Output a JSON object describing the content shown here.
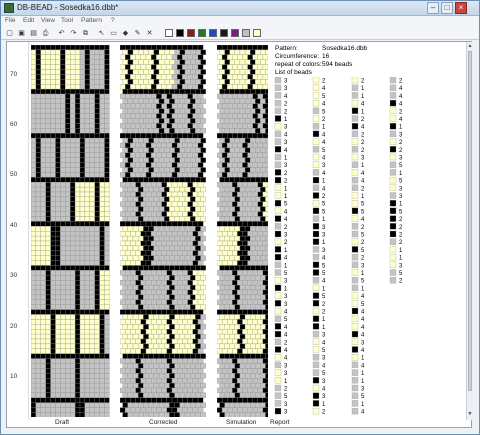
{
  "window": {
    "title": "DB-BEAD - Sosedka16.dbb*",
    "min": "–",
    "max": "□",
    "close": "×"
  },
  "menu": [
    "File",
    "Edit",
    "View",
    "Tool",
    "Pattern",
    "?"
  ],
  "toolbar": {
    "icons": [
      "new-icon",
      "open-icon",
      "save-icon",
      "print-icon",
      "undo-icon",
      "redo-icon",
      "copy-icon",
      "select-arrow-icon",
      "rect-select-icon",
      "fill-icon",
      "pencil-icon",
      "clear-icon"
    ],
    "glyphs": [
      "▢",
      "▣",
      "▤",
      "⎙",
      "↶",
      "↷",
      "⧉",
      "↖",
      "▭",
      "◆",
      "✎",
      "✕"
    ],
    "colors": [
      "#ffffff",
      "#000000",
      "#8b1a1a",
      "#1f7a1f",
      "#1c4bc7",
      "#1a1a1a",
      "#7a1a8b",
      "#c0c0c0",
      "#ffffcc"
    ]
  },
  "ruler": [
    "70",
    "60",
    "50",
    "40",
    "30",
    "20",
    "10"
  ],
  "panels": {
    "draft": "Draft",
    "corrected": "Corrected",
    "simulation": "Simulation",
    "report": "Report"
  },
  "report": {
    "pattern_label": "Pattern:",
    "pattern_value": "Sosedka16.dbb",
    "circ_label": "Circumference:",
    "circ_value": "16",
    "repeat_label": "repeat of colors:",
    "repeat_value": "594 beads",
    "list_label": "List of beads"
  },
  "bead_colors": {
    "yellow": "#ffffc8",
    "gray": "#c3c3c3",
    "black": "#000000",
    "grid": "#8a8a8a"
  }
}
